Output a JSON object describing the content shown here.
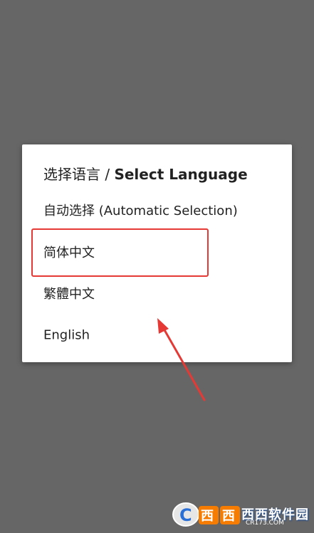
{
  "dialog": {
    "title_cn": "选择语言",
    "title_sep": " / ",
    "title_en": "Select Language",
    "options": [
      {
        "label": "自动选择 (Automatic Selection)"
      },
      {
        "label": "简体中文"
      },
      {
        "label": "繁體中文"
      },
      {
        "label": "English"
      }
    ]
  },
  "annotation": {
    "highlighted_option": "简体中文",
    "color": "#e53935"
  },
  "watermark": {
    "brand": "西西软件园",
    "domain": "CR173.COM"
  },
  "colors": {
    "backdrop": "#666666",
    "dialog_bg": "#ffffff",
    "text": "#222222",
    "annotation": "#e53935"
  }
}
